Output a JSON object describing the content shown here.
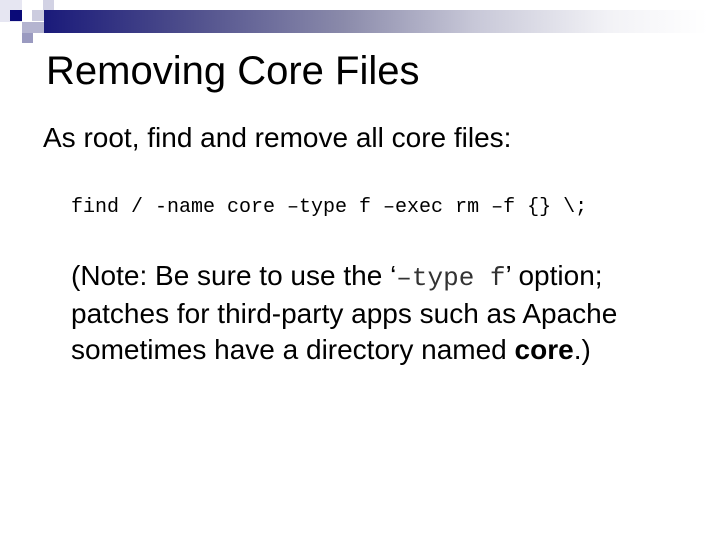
{
  "slide": {
    "title": "Removing Core Files",
    "lead": "As root, find and remove all core files:",
    "command": "find / -name core –type f –exec rm –f {} \\;",
    "note": {
      "open": "(Note: Be sure to use the ",
      "quote_open": "‘",
      "option_code": "–type f",
      "quote_close": "’",
      "middle": " option; patches for third-party apps such as Apache sometimes have a directory named ",
      "emphasis": "core",
      "close": ".)"
    }
  },
  "theme": {
    "accent_dark": "#1a1a7a",
    "accent_mid": "#8a8aaa",
    "accent_light": "#c8c8e0"
  }
}
